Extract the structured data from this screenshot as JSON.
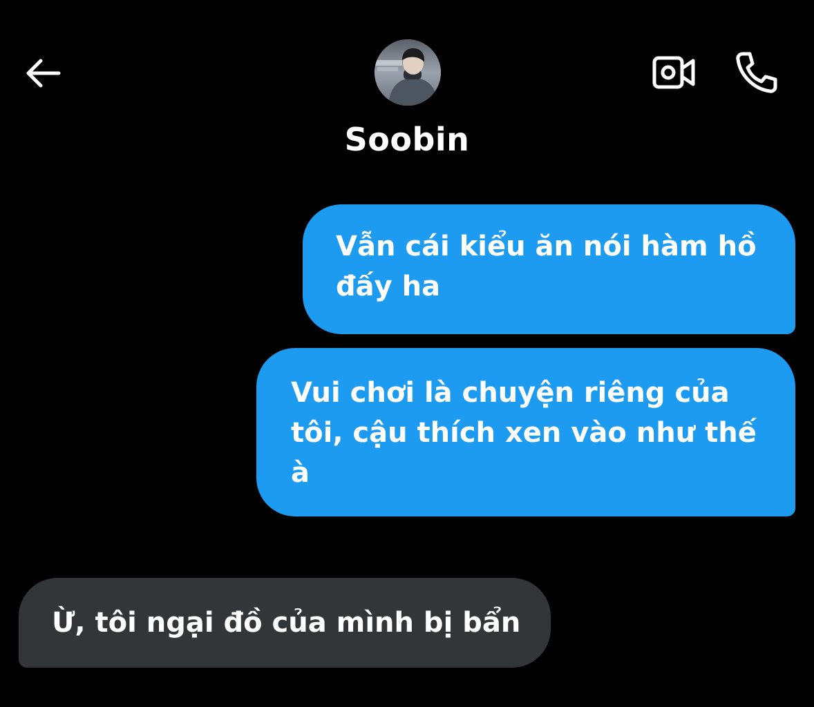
{
  "header": {
    "contact_name": "Soobin",
    "icons": {
      "back": "arrow-left-icon",
      "video": "video-camera-icon",
      "call": "phone-icon"
    }
  },
  "messages": [
    {
      "direction": "outgoing",
      "text": "Vẫn cái kiểu ăn nói hàm hồ đấy ha"
    },
    {
      "direction": "outgoing",
      "text": "Vui chơi là chuyện riêng của tôi, cậu thích xen vào như thế à"
    },
    {
      "direction": "incoming",
      "text": "Ừ, tôi ngại đồ của mình bị bẩn"
    }
  ],
  "colors": {
    "background": "#000000",
    "outgoing_bubble": "#1d9bf0",
    "incoming_bubble": "#333639",
    "text": "#ffffff"
  }
}
